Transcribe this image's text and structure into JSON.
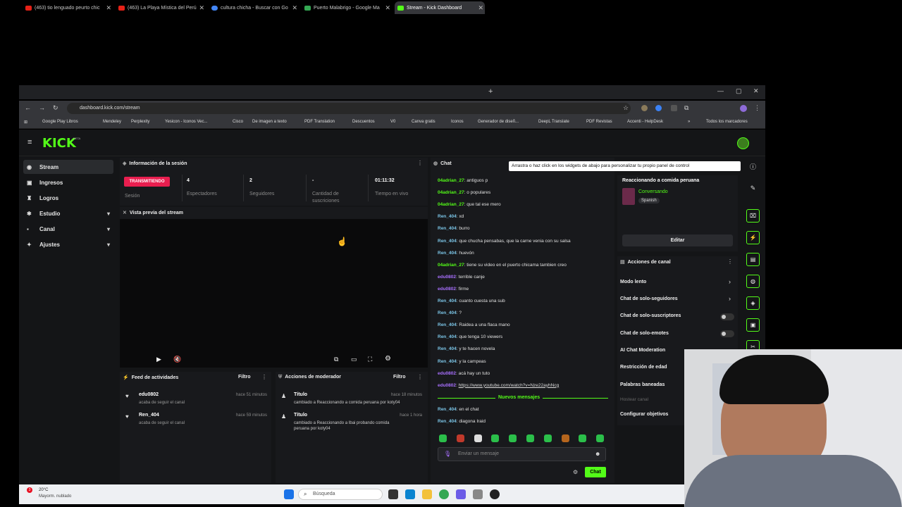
{
  "browser": {
    "tabs": [
      {
        "title": "(463) tio lenguado peurto chic",
        "color": "#e62117"
      },
      {
        "title": "(463) La Playa Mística del Perú",
        "color": "#e62117"
      },
      {
        "title": "cultura chicha - Buscar con Go",
        "color": "#4285f4"
      },
      {
        "title": "Puerto Malabrigo - Google Ma",
        "color": "#34a853"
      },
      {
        "title": "Stream - Kick Dashboard",
        "color": "#53fc18"
      }
    ],
    "url": "dashboard.kick.com/stream",
    "bookmarks": [
      "Google Play Libros",
      "Mendeley",
      "Perplexity",
      "Yesicon - Iconos Vec...",
      "Cisco",
      "De imagen a texto",
      "PDF Translation",
      "Descuentos",
      "V0",
      "Canva gratis",
      "Iconos",
      "Generador de diseñ...",
      "DeepL Translate",
      "PDF Revistas",
      "Accenti - HelpDesk",
      "Todos los marcadores"
    ]
  },
  "app": {
    "logo": "KICK",
    "logo_badge": "BETA",
    "sidebar": [
      {
        "label": "Stream",
        "icon": "stream-icon"
      },
      {
        "label": "Ingresos",
        "icon": "money-icon"
      },
      {
        "label": "Logros",
        "icon": "trophy-icon"
      },
      {
        "label": "Estudio",
        "icon": "studio-icon"
      },
      {
        "label": "Canal",
        "icon": "channel-icon"
      },
      {
        "label": "Ajustes",
        "icon": "settings-icon"
      }
    ],
    "session": {
      "title": "Información de la sesión",
      "live_badge": "TRANSMITIENDO",
      "session_label": "Sesión",
      "viewers": "4",
      "viewers_label": "Espectadores",
      "followers": "2",
      "followers_label": "Seguidores",
      "subs": "-",
      "subs_label": "Cantidad de suscriciones",
      "live_time": "01:11:32",
      "live_time_label": "Tiempo en vivo"
    },
    "preview_title": "Vista previa del stream",
    "activity": {
      "title": "Feed de actividades",
      "filter": "Filtro",
      "items": [
        {
          "name": "edu0802",
          "sub": "acaba de seguir el canal",
          "time": "hace 51 minutos"
        },
        {
          "name": "Ren_404",
          "sub": "acaba de seguir el canal",
          "time": "hace 59 minutos"
        }
      ]
    },
    "moderator": {
      "title": "Acciones de moderador",
      "filter": "Filtro",
      "items": [
        {
          "name": "Título",
          "line1": "cambiado a Reaccionando a comida peruana por koty04",
          "time": "hace 18 minutos"
        },
        {
          "name": "Título",
          "line1": "cambiado a Reaccionando a Ibai probando comida",
          "line2": "peruana por koty04",
          "time": "hace 1 hora"
        }
      ]
    },
    "chat": {
      "title": "Chat",
      "messages": [
        {
          "user": "04adrian_27",
          "text": "antiguos p",
          "color": "#53fc18"
        },
        {
          "user": "04adrian_27",
          "text": "o populares",
          "color": "#53fc18"
        },
        {
          "user": "04adrian_27",
          "text": "que tal ese mero",
          "color": "#53fc18"
        },
        {
          "user": "Ren_404",
          "text": "xd",
          "color": "#7cc6e8"
        },
        {
          "user": "Ren_404",
          "text": "burro",
          "color": "#7cc6e8"
        },
        {
          "user": "Ren_404",
          "text": "que chucha pensabas, que la carne venia con su salsa",
          "color": "#7cc6e8"
        },
        {
          "user": "Ren_404",
          "text": "huevón",
          "color": "#7cc6e8"
        },
        {
          "user": "04adrian_27",
          "text": "tiene su video en el puerto chicama tambien creo",
          "color": "#53fc18"
        },
        {
          "user": "edu0802",
          "text": "terrible canje",
          "color": "#a970ff"
        },
        {
          "user": "edu0802",
          "text": "firme",
          "color": "#a970ff"
        },
        {
          "user": "Ren_404",
          "text": "cuanto cuesta una sub",
          "color": "#7cc6e8"
        },
        {
          "user": "Ren_404",
          "text": "?",
          "color": "#7cc6e8"
        },
        {
          "user": "Ren_404",
          "text": "Raidea a una flaca mano",
          "color": "#7cc6e8"
        },
        {
          "user": "Ren_404",
          "text": "que tenga 10 viewers",
          "color": "#7cc6e8"
        },
        {
          "user": "Ren_404",
          "text": "y te hacen novela",
          "color": "#7cc6e8"
        },
        {
          "user": "Ren_404",
          "text": "y la campeas",
          "color": "#7cc6e8"
        },
        {
          "user": "edu0802",
          "text": "acá hay un tuto",
          "color": "#a970ff"
        },
        {
          "user": "edu0802",
          "text": "https://www.youtube.com/watch?v=Nze22ayhNcg",
          "color": "#a970ff"
        }
      ],
      "new_messages_label": "Nuevos mensajes",
      "new_messages": [
        {
          "user": "Ren_404",
          "text": "en el chat",
          "color": "#7cc6e8"
        },
        {
          "user": "Ren_404",
          "text": "diagona Iraid",
          "color": "#7cc6e8"
        }
      ],
      "input_placeholder": "Enviar un mensaje",
      "send_label": "Chat"
    },
    "tooltip": "Arrastra o haz click en los widgets de abajo para personalizar tu propio panel de control",
    "stream_info": {
      "title": "Reaccionando a comida peruana",
      "category": "Conversando",
      "language": "Spanish",
      "edit_label": "Editar"
    },
    "channel_actions": {
      "title": "Acciones de canal",
      "rows": [
        "Modo lento",
        "Chat de solo-seguidores",
        "Chat de solo-suscriptores",
        "Chat de solo-emotes",
        "AI Chat Moderation",
        "Restricción de edad",
        "Palabras baneadas",
        "Hostear canal",
        "Configurar objetivos"
      ]
    }
  },
  "taskbar": {
    "weather_temp": "20°C",
    "weather_desc": "Mayorm. nublado",
    "search_placeholder": "Búsqueda",
    "notif_count": "3"
  }
}
